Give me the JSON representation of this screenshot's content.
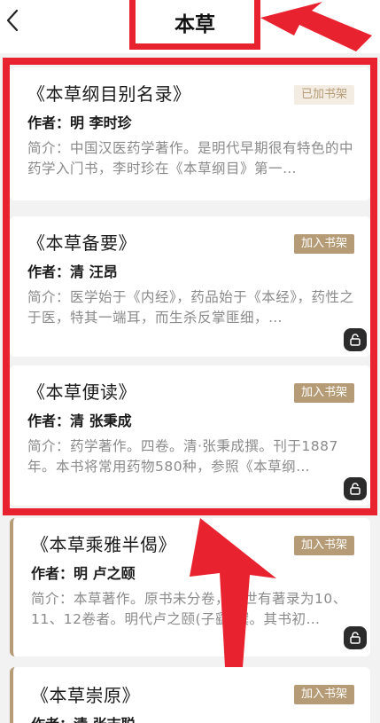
{
  "header": {
    "back_icon": "chevron-left-icon",
    "title": "本草"
  },
  "books": [
    {
      "title": "《本草纲目别名录》",
      "author": "作者：明 李时珍",
      "intro": "简介：中国汉医药学著作。是明代早期很有特色的中药学入门书，李时珍在《本草纲目》第一…",
      "shelf_label": "已加书架",
      "shelf_state": "added"
    },
    {
      "title": "《本草备要》",
      "author": "作者：清 汪昂",
      "intro": "简介：医学始于《内经》，药品始于《本经》，药性之于医，特其一端耳，而生杀反掌匪细，…",
      "shelf_label": "加入书架",
      "shelf_state": "add"
    },
    {
      "title": "《本草便读》",
      "author": "作者：清 张秉成",
      "intro": "简介：药学著作。四卷。清·张秉成撰。刊于1887年。本书将常用药物580种，参照《本草纲…",
      "shelf_label": "加入书架",
      "shelf_state": "add"
    },
    {
      "title": "《本草乘雅半偈》",
      "author": "作者：明 卢之颐",
      "intro": "简介：本草著作。原书未分卷，后世有著录为10、11、12卷者。明代卢之颐(子繇)撰。其书初…",
      "shelf_label": "加入书架",
      "shelf_state": "add"
    },
    {
      "title": "《本草崇原》",
      "author": "作者：清 张志聪",
      "intro": "",
      "shelf_label": "加入书架",
      "shelf_state": "add"
    }
  ],
  "colors": {
    "annotation_red": "#e8222e",
    "accent_gold": "#b59b76",
    "background": "#f2f2f2"
  }
}
